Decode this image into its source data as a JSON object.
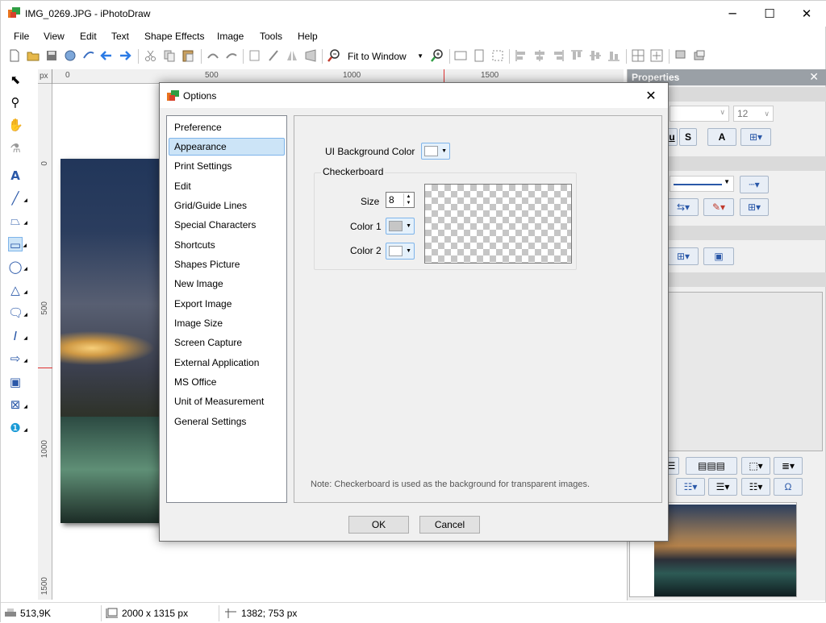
{
  "window": {
    "title": "IMG_0269.JPG - iPhotoDraw",
    "minimize_glyph": "─",
    "maximize_glyph": "☐",
    "close_glyph": "✕"
  },
  "menu": [
    "File",
    "View",
    "Edit",
    "Text",
    "Shape Effects",
    "Image",
    "Tools",
    "Help"
  ],
  "toolbar": {
    "zoom_value": "Fit to Window"
  },
  "rulers": {
    "unit": "px",
    "h_ticks": [
      "0",
      "500",
      "1000",
      "1500"
    ],
    "v_ticks": [
      "0",
      "500",
      "1000",
      "1500"
    ]
  },
  "properties_panel": {
    "title": "Properties",
    "font_size": "12",
    "underline": "u",
    "strike": "S",
    "text_color": "A",
    "omega": "Ω"
  },
  "dialog": {
    "title": "Options",
    "nav_items": [
      "Preference",
      "Appearance",
      "Print Settings",
      "Edit",
      "Grid/Guide Lines",
      "Special Characters",
      "Shortcuts",
      "Shapes Picture",
      "New Image",
      "Export Image",
      "Image Size",
      "Screen Capture",
      "External Application",
      "MS Office",
      "Unit of Measurement",
      "General Settings"
    ],
    "selected_index": 1,
    "ui_bg_label": "UI Background Color",
    "ui_bg_color": "#ffffff",
    "checkerboard_label": "Checkerboard",
    "size_label": "Size",
    "size_value": "8",
    "color1_label": "Color 1",
    "color1": "#c6c6c6",
    "color2_label": "Color 2",
    "color2": "#ffffff",
    "note": "Note: Checkerboard is used as the background for transparent images.",
    "ok_label": "OK",
    "cancel_label": "Cancel"
  },
  "status": {
    "file_size": "513,9K",
    "image_dimensions": "2000 x 1315 px",
    "cursor_position": "1382; 753 px"
  },
  "colors": {
    "accent": "#2a58a8",
    "selection_bg": "#cce4f7",
    "selection_border": "#7eb4ea",
    "ruler_marker": "#e03030"
  }
}
